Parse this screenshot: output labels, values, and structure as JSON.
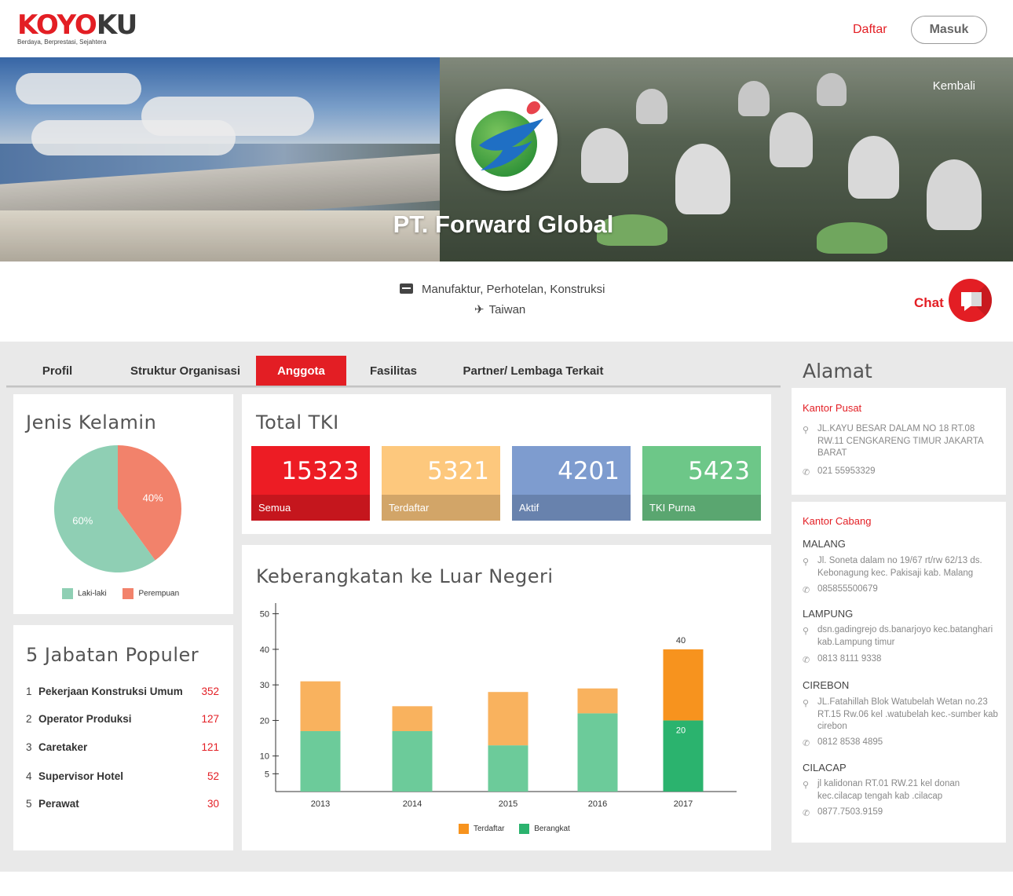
{
  "header": {
    "brand_red": "KOYO",
    "brand_dark": "KU",
    "tagline": "Berdaya, Berprestasi, Sejahtera",
    "daftar_label": "Daftar",
    "masuk_label": "Masuk"
  },
  "hero": {
    "company_name": "PT. Forward Global",
    "back_label": "Kembali"
  },
  "info": {
    "industries": "Manufaktur, Perhotelan, Konstruksi",
    "country": "Taiwan",
    "chat_label": "Chat"
  },
  "tabs": [
    "Profil",
    "Struktur Organisasi",
    "Anggota",
    "Fasilitas",
    "Partner/ Lembaga Terkait"
  ],
  "active_tab": "Anggota",
  "gender": {
    "title": "Jenis Kelamin",
    "male_label": "Laki-laki",
    "female_label": "Perempuan",
    "male_pct_label": "60%",
    "female_pct_label": "40%"
  },
  "total": {
    "title": "Total TKI",
    "stats": [
      {
        "value": "15323",
        "label": "Semua"
      },
      {
        "value": "5321",
        "label": "Terdaftar"
      },
      {
        "value": "4201",
        "label": "Aktif"
      },
      {
        "value": "5423",
        "label": "TKI Purna"
      }
    ]
  },
  "jobs": {
    "title": "5 Jabatan Populer",
    "items": [
      {
        "rank": "1",
        "name": "Pekerjaan Konstruksi Umum",
        "count": "352"
      },
      {
        "rank": "2",
        "name": "Operator Produksi",
        "count": "127"
      },
      {
        "rank": "3",
        "name": "Caretaker",
        "count": "121"
      },
      {
        "rank": "4",
        "name": "Supervisor Hotel",
        "count": "52"
      },
      {
        "rank": "5",
        "name": "Perawat",
        "count": "30"
      }
    ]
  },
  "departures": {
    "title": "Keberangkatan ke Luar Negeri",
    "legend_registered": "Terdaftar",
    "legend_departed": "Berangkat"
  },
  "address": {
    "title": "Alamat",
    "head_office_label": "Kantor Pusat",
    "head_office_address": "JL.KAYU BESAR DALAM NO 18 RT.08 RW.11 CENGKARENG TIMUR JAKARTA BARAT",
    "head_office_phone": "021 55953329",
    "branch_label": "Kantor Cabang",
    "branches": [
      {
        "city": "MALANG",
        "address": "Jl. Soneta dalam no 19/67 rt/rw 62/13 ds. Kebonagung kec. Pakisaji kab. Malang",
        "phone": "085855500679"
      },
      {
        "city": "LAMPUNG",
        "address": "dsn.gadingrejo ds.banarjoyo kec.batanghari kab.Lampung timur",
        "phone": "0813 8111 9338"
      },
      {
        "city": "CIREBON",
        "address": "JL.Fatahillah Blok Watubelah Wetan no.23 RT.15 Rw.06 kel .watubelah kec.-sumber kab cirebon",
        "phone": "0812 8538 4895"
      },
      {
        "city": "CILACAP",
        "address": "jl kalidonan RT.01 RW.21 kel donan kec.cilacap tengah kab .cilacap",
        "phone": "0877.7503.9159"
      }
    ]
  },
  "colors": {
    "brand_red": "#e31e24",
    "male": "#8fcfb4",
    "female": "#f2826b",
    "stat_all": "#ed1c24",
    "stat_registered": "#fdc87d",
    "stat_active": "#7e9ccf",
    "stat_alumni": "#6dc788",
    "bar_registered": "#f9b25e",
    "bar_departed": "#6ccb9a",
    "bar_registered_highlight": "#f7931e",
    "bar_departed_highlight": "#2bb36e"
  },
  "chart_data": [
    {
      "type": "pie",
      "title": "Jenis Kelamin",
      "categories": [
        "Laki-laki",
        "Perempuan"
      ],
      "values": [
        60,
        40
      ],
      "legend": "bottom"
    },
    {
      "type": "bar",
      "stacked": true,
      "title": "Keberangkatan ke Luar Negeri",
      "categories": [
        "2013",
        "2014",
        "2015",
        "2016",
        "2017"
      ],
      "series": [
        {
          "name": "Berangkat",
          "values": [
            17,
            17,
            13,
            22,
            20
          ]
        },
        {
          "name": "Terdaftar",
          "values": [
            14,
            7,
            15,
            7,
            20
          ]
        }
      ],
      "yticks": [
        5,
        10,
        20,
        30,
        40,
        50
      ],
      "ylim": [
        0,
        53
      ],
      "data_labels": [
        {
          "category": "2017",
          "series": "Berangkat",
          "text": "20"
        },
        {
          "category": "2017",
          "series": "total",
          "text": "40"
        }
      ],
      "legend": "bottom",
      "grid": false
    }
  ]
}
